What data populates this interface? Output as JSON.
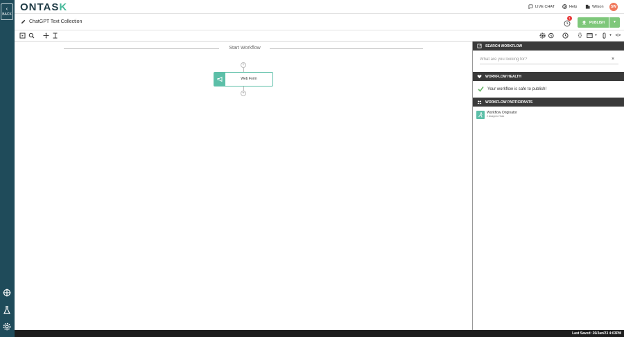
{
  "sidebar": {
    "back_label": "BACK",
    "bottom_icons": [
      "crosshair-icon",
      "flask-icon",
      "gear-icon"
    ]
  },
  "topbar": {
    "logo_main": "ONTAS",
    "logo_accent": "K",
    "live_chat_label": "LIVE CHAT",
    "help_label": "Help",
    "user_label": "Wilson",
    "avatar_initials": "SW"
  },
  "titlebar": {
    "workflow_title": "ChatGPT Text Collection",
    "alert_count": "1",
    "publish_label": "PUBLISH"
  },
  "canvas": {
    "start_label": "Start Workflow",
    "nodes": [
      {
        "label": "Web Form"
      }
    ]
  },
  "panel": {
    "search_header": "SEARCH WORKFLOW",
    "search_placeholder": "What are you looking for?",
    "health_header": "WORKFLOW HEALTH",
    "health_message": "Your workflow is safe to publish!",
    "participants_header": "WORKFLOW PARTICIPANTS",
    "participants": [
      {
        "name": "Workflow Originator",
        "sub": "2 Assigned Task"
      }
    ]
  },
  "statusbar": {
    "last_saved": "Last Saved: 26/Jan/23 4:03PM"
  },
  "colors": {
    "sidebar_bg": "#1f4b5a",
    "accent": "#5cbfa8",
    "publish": "#7ec77a",
    "panel_header_bg": "#3a3a3a",
    "alert": "#e8393a"
  }
}
